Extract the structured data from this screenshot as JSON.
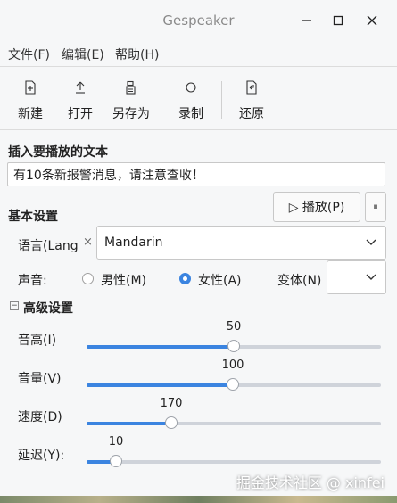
{
  "window": {
    "title": "Gespeaker"
  },
  "menu": [
    {
      "label": "文件(F)"
    },
    {
      "label": "编辑(E)"
    },
    {
      "label": "帮助(H)"
    }
  ],
  "toolbar": {
    "new_label": "新建",
    "open_label": "打开",
    "save_as_label": "另存为",
    "record_label": "录制",
    "restore_label": "还原"
  },
  "insert_text": {
    "header": "插入要播放的文本",
    "value": "有10条新报警消息，请注意查收！"
  },
  "basic": {
    "header": "基本设置",
    "play_label": "▷ 播放(P)",
    "pause_label": "⏸",
    "language_label": "语言(Langu",
    "language_clear": "×",
    "language_value": "Mandarin",
    "voice_label": "声音:",
    "male_label": "男性(M)",
    "female_label": "女性(A)",
    "selected_voice": "female",
    "variant_label": "变体(N)",
    "variant_value": ""
  },
  "advanced": {
    "toggle": "−",
    "header": "高级设置",
    "sliders": [
      {
        "label": "音高(I)",
        "value": "50",
        "fraction": 0.5
      },
      {
        "label": "音量(V)",
        "value": "100",
        "fraction": 0.497
      },
      {
        "label": "速度(D)",
        "value": "170",
        "fraction": 0.288
      },
      {
        "label": "延迟(Y):",
        "value": "10",
        "fraction": 0.1
      }
    ]
  },
  "watermark": "掘金技术社区 @ xinfei",
  "colors": {
    "accent": "#3b84e0",
    "track": "#cfd3da"
  }
}
